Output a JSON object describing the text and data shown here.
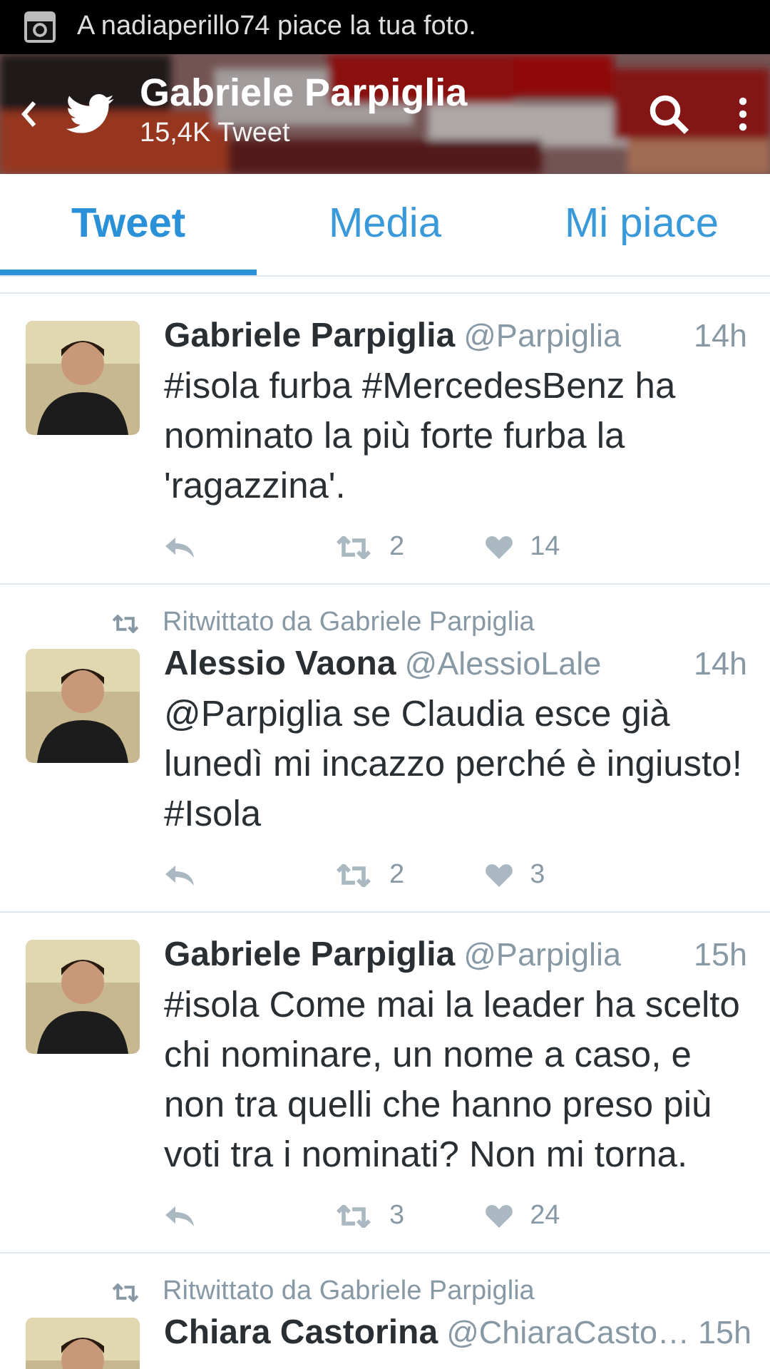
{
  "status_bar": {
    "notification": "A nadiaperillo74 piace la tua foto."
  },
  "header": {
    "title": "Gabriele Parpiglia",
    "subtitle": "15,4K Tweet"
  },
  "tabs": [
    {
      "label": "Tweet",
      "selected": true
    },
    {
      "label": "Media",
      "selected": false
    },
    {
      "label": "Mi piace",
      "selected": false
    }
  ],
  "tweets": [
    {
      "name": "Gabriele Parpiglia",
      "handle": "@Parpiglia",
      "time": "14h",
      "text": "#isola furba #MercedesBenz ha nominato la più forte furba la 'ragazzina'.",
      "retweets": "2",
      "likes": "14"
    },
    {
      "retweeted_by": "Ritwittato da Gabriele Parpiglia",
      "name": "Alessio Vaona",
      "handle": "@AlessioLale",
      "time": "14h",
      "text": "@Parpiglia se Claudia esce già lunedì mi incazzo perché è ingiusto! #Isola",
      "retweets": "2",
      "likes": "3"
    },
    {
      "name": "Gabriele Parpiglia",
      "handle": "@Parpiglia",
      "time": "15h",
      "text": "#isola Come mai la leader ha scelto chi nominare, un nome a caso, e non tra quelli che hanno preso più voti tra i nominati? Non mi torna.",
      "retweets": "3",
      "likes": "24"
    },
    {
      "retweeted_by": "Ritwittato da Gabriele Parpiglia",
      "name": "Chiara Castorina",
      "handle": "@ChiaraCasto…",
      "time": "15h"
    }
  ]
}
